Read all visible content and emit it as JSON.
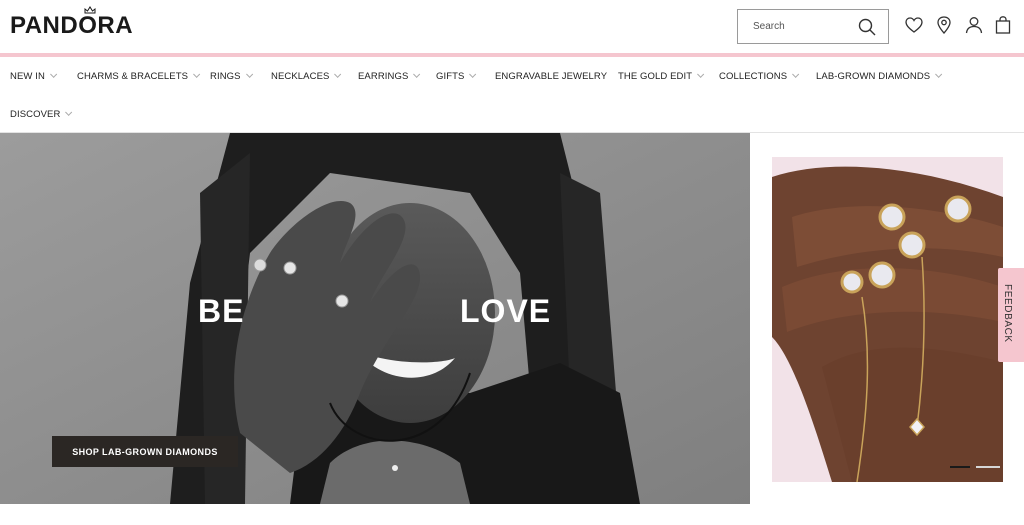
{
  "brand": {
    "logo_text": "PANDORA"
  },
  "search": {
    "placeholder": "Search"
  },
  "header_icons": [
    "heart-icon",
    "location-pin-icon",
    "user-icon",
    "shopping-bag-icon"
  ],
  "nav": {
    "items": [
      {
        "label": "NEW IN",
        "has_dropdown": true
      },
      {
        "label": "CHARMS & BRACELETS",
        "has_dropdown": true
      },
      {
        "label": "RINGS",
        "has_dropdown": true
      },
      {
        "label": "NECKLACES",
        "has_dropdown": true
      },
      {
        "label": "EARRINGS",
        "has_dropdown": true
      },
      {
        "label": "GIFTS",
        "has_dropdown": true
      },
      {
        "label": "ENGRAVABLE JEWELRY",
        "has_dropdown": false
      },
      {
        "label": "THE GOLD EDIT",
        "has_dropdown": true
      },
      {
        "label": "COLLECTIONS",
        "has_dropdown": true
      },
      {
        "label": "LAB-GROWN DIAMONDS",
        "has_dropdown": true
      },
      {
        "label": "DISCOVER",
        "has_dropdown": true
      }
    ]
  },
  "hero": {
    "text_left": "BE",
    "text_right": "LOVE",
    "cta_label": "SHOP LAB-GROWN DIAMONDS"
  },
  "feedback": {
    "label": "FEEDBACK"
  },
  "colors": {
    "accent_pink": "#f5c6cf",
    "cta_dark": "#2b2724",
    "text_dark": "#1a1a1a"
  }
}
